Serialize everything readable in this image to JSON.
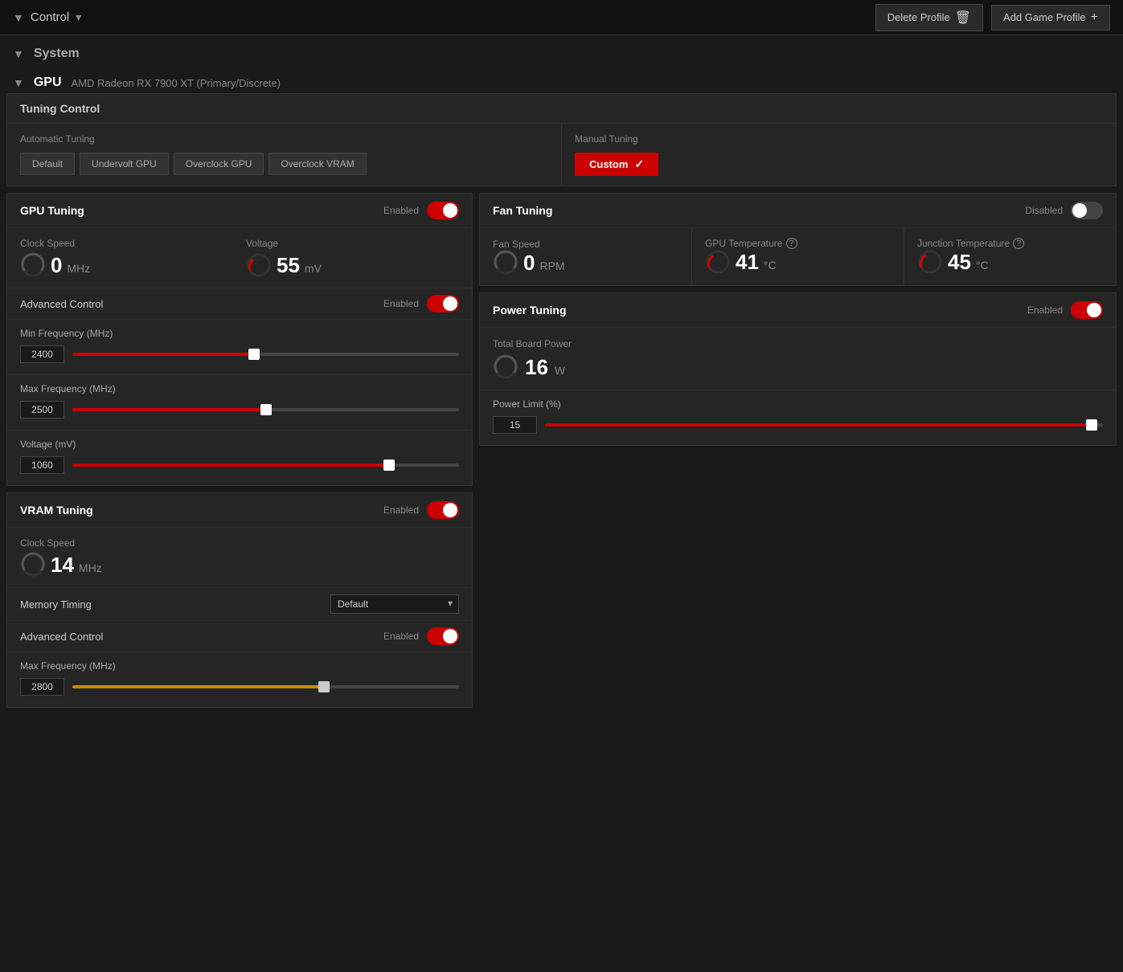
{
  "topbar": {
    "title": "Control",
    "delete_profile_label": "Delete Profile",
    "add_game_profile_label": "Add Game Profile"
  },
  "system": {
    "label": "System"
  },
  "gpu": {
    "label": "GPU",
    "description": "AMD Radeon RX 7900 XT (Primary/Discrete)"
  },
  "tuning_control": {
    "title": "Tuning Control",
    "automatic_label": "Automatic Tuning",
    "manual_label": "Manual Tuning",
    "auto_buttons": [
      "Default",
      "Undervolt GPU",
      "Overclock GPU",
      "Overclock VRAM"
    ],
    "manual_custom_label": "Custom"
  },
  "gpu_tuning": {
    "title": "GPU Tuning",
    "status": "Enabled",
    "enabled": true,
    "clock_speed_label": "Clock Speed",
    "clock_speed_value": "0",
    "clock_speed_unit": "MHz",
    "voltage_label": "Voltage",
    "voltage_value": "55",
    "voltage_unit": "mV",
    "advanced_control_label": "Advanced Control",
    "advanced_status": "Enabled",
    "advanced_enabled": true,
    "min_freq_label": "Min Frequency (MHz)",
    "min_freq_value": "2400",
    "min_freq_percent": 47,
    "max_freq_label": "Max Frequency (MHz)",
    "max_freq_value": "2500",
    "max_freq_percent": 50,
    "voltage_mv_label": "Voltage (mV)",
    "voltage_mv_value": "1060",
    "voltage_mv_percent": 82
  },
  "fan_tuning": {
    "title": "Fan Tuning",
    "status": "Disabled",
    "enabled": false,
    "fan_speed_label": "Fan Speed",
    "fan_speed_value": "0",
    "fan_speed_unit": "RPM",
    "gpu_temp_label": "GPU Temperature",
    "gpu_temp_value": "41",
    "gpu_temp_unit": "°C",
    "junction_temp_label": "Junction Temperature",
    "junction_temp_value": "45",
    "junction_temp_unit": "°C"
  },
  "power_tuning": {
    "title": "Power Tuning",
    "status": "Enabled",
    "enabled": true,
    "total_board_power_label": "Total Board Power",
    "total_board_power_value": "16",
    "total_board_power_unit": "W",
    "power_limit_label": "Power Limit (%)",
    "power_limit_value": "15",
    "power_limit_percent": 98
  },
  "vram_tuning": {
    "title": "VRAM Tuning",
    "status": "Enabled",
    "enabled": true,
    "clock_speed_label": "Clock Speed",
    "clock_speed_value": "14",
    "clock_speed_unit": "MHz",
    "memory_timing_label": "Memory Timing",
    "memory_timing_value": "Default",
    "advanced_control_label": "Advanced Control",
    "advanced_status": "Enabled",
    "advanced_enabled": true,
    "max_freq_label": "Max Frequency (MHz)",
    "max_freq_value": "2800",
    "max_freq_percent": 65
  }
}
